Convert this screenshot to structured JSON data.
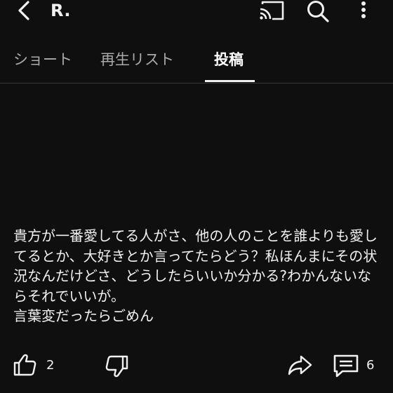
{
  "header": {
    "channel_name": "R.",
    "back_icon": "back-arrow-icon",
    "cast_icon": "cast-icon",
    "search_icon": "search-icon",
    "more_icon": "more-vertical-icon"
  },
  "tabs": [
    {
      "label": "ショート",
      "active": false
    },
    {
      "label": "再生リスト",
      "active": false
    },
    {
      "label": "投稿",
      "active": true
    }
  ],
  "post": {
    "text": "貴方が一番愛してる人がさ、他の人のことを誰よりも愛してるとか、大好きとか言ってたらどう？私ほんまにその状況なんだけどさ、どうしたらいいか分かる?わかんないならそれでいいが。\n言葉変だったらごめん",
    "like_count": "2",
    "comment_count": "6"
  },
  "colors": {
    "background": "#0f0f0f",
    "text": "#f1f1f1",
    "inactive_tab": "#aaaaaa",
    "divider": "#3a3a3a"
  }
}
